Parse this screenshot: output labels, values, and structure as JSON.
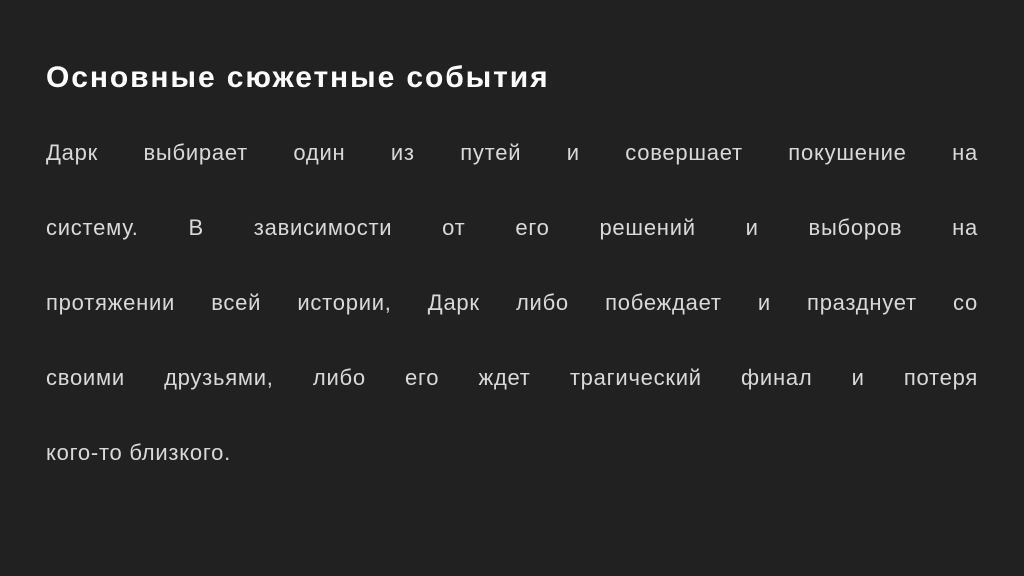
{
  "slide": {
    "background_color": "#212121",
    "title": "Основные сюжетные события",
    "title_color": "#ffffff",
    "body_color": "#d9d9d9",
    "body_text": "Дарк выбирает один из путей и совершает покушение на систему. В зависимости от его решений и выборов на протяжении всей истории, Дарк либо побеждает и празднует со своими друзьями, либо его ждет трагический финал и потеря кого-то близкого.",
    "body_lines": [
      "Дарк выбирает один из путей и совершает покушение на",
      "систему. В зависимости от его решений и выборов на",
      "протяжении всей истории, Дарк либо побеждает и празднует со",
      "своими друзьями, либо его ждет трагический финал и потеря",
      "кого-то близкого."
    ]
  }
}
